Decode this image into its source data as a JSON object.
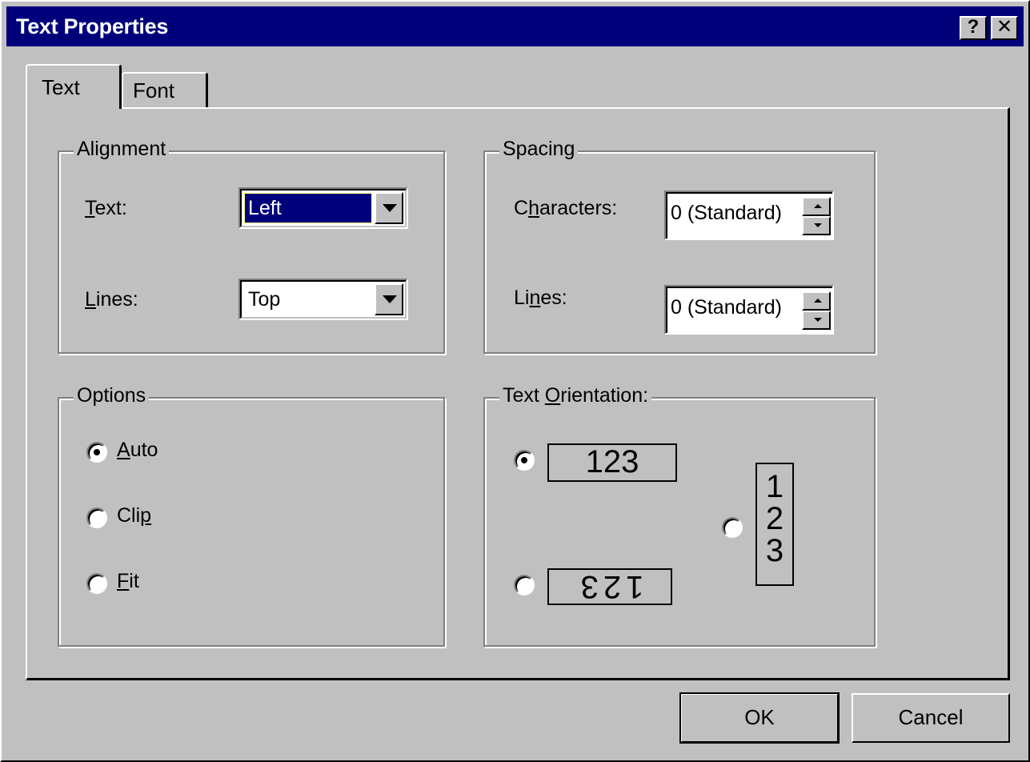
{
  "window": {
    "title": "Text Properties",
    "help_label": "?",
    "close_label": "✕"
  },
  "tabs": [
    {
      "label": "Text",
      "active": true
    },
    {
      "label": "Font",
      "active": false
    }
  ],
  "alignment": {
    "title": "Alignment",
    "text_label_u": "T",
    "text_label_rest": "ext:",
    "text_value": "Left",
    "lines_label_u": "L",
    "lines_label_rest": "ines:",
    "lines_value": "Top"
  },
  "spacing": {
    "title": "Spacing",
    "chars_label_pre": "C",
    "chars_label_u": "h",
    "chars_label_rest": "aracters:",
    "chars_value": "0 (Standard)",
    "lines_label_pre": "Li",
    "lines_label_u": "n",
    "lines_label_rest": "es:",
    "lines_value": "0 (Standard)"
  },
  "options": {
    "title": "Options",
    "items": [
      {
        "pre": "",
        "u": "A",
        "rest": "uto",
        "checked": true
      },
      {
        "pre": "Cli",
        "u": "p",
        "rest": "",
        "checked": false
      },
      {
        "pre": "",
        "u": "F",
        "rest": "it",
        "checked": false
      }
    ]
  },
  "orientation": {
    "title_pre": "Text ",
    "title_u": "O",
    "title_rest": "rientation:",
    "horizontal": "123",
    "vertical_1": "1",
    "vertical_2": "2",
    "vertical_3": "3",
    "rotated": "123",
    "selected": "horizontal"
  },
  "buttons": {
    "ok": "OK",
    "cancel": "Cancel"
  }
}
